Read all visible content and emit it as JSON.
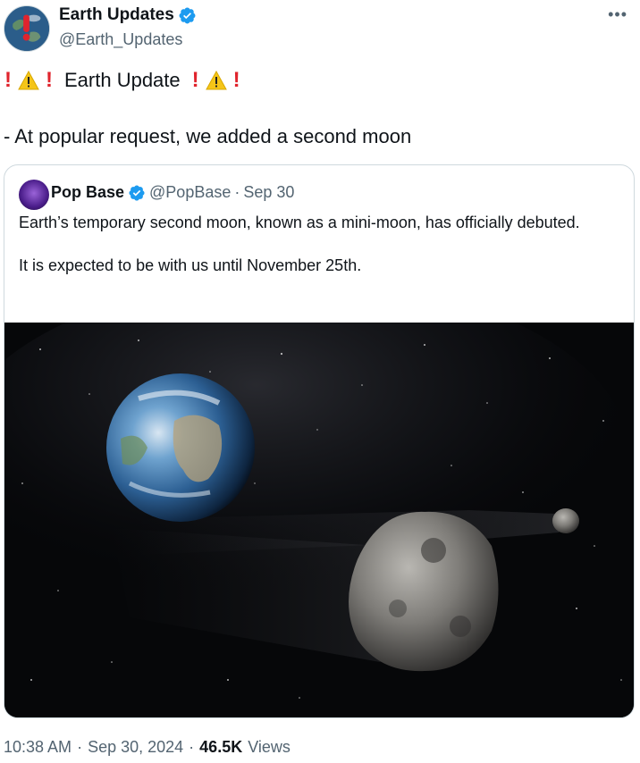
{
  "author": {
    "display_name": "Earth Updates",
    "handle": "@Earth_Updates",
    "verified": true,
    "avatar_icon": "earth-warning-avatar"
  },
  "more_label": "•••",
  "headline": {
    "text": "Earth Update",
    "left_icons": [
      "exclamation-icon",
      "warning-icon",
      "exclamation-icon"
    ],
    "right_icons": [
      "exclamation-icon",
      "warning-icon",
      "exclamation-icon"
    ]
  },
  "body": "- At popular request, we added a second moon",
  "quoted": {
    "display_name": "Pop Base",
    "handle": "@PopBase",
    "separator": "·",
    "date": "Sep 30",
    "verified": true,
    "paragraphs": [
      "Earth’s temporary second moon, known as a mini-moon, has officially debuted.",
      "It is expected to be with us until November 25th."
    ],
    "media_icon": "earth-and-asteroid-image"
  },
  "footer": {
    "time": "10:38 AM",
    "separator": "·",
    "date": "Sep 30, 2024",
    "separator2": "·",
    "views_count": "46.5K",
    "views_label": "Views"
  },
  "colors": {
    "text_primary": "#0f1419",
    "text_secondary": "#536471",
    "verified_blue": "#1d9bf0",
    "exclamation_red": "#e0242d",
    "warning_yellow": "#f5c518",
    "border": "#cfd9de"
  }
}
